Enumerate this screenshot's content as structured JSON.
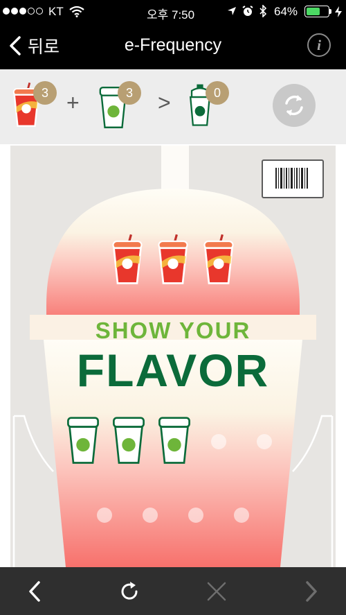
{
  "status_bar": {
    "carrier": "KT",
    "time": "오후 7:50",
    "battery_percent": "64%",
    "signal_bars_filled": 3,
    "signal_bars_total": 5,
    "battery_level": 0.64
  },
  "nav": {
    "back_label": "뒤로",
    "title": "e-Frequency",
    "info_glyph": "i"
  },
  "progress": {
    "seasonal_count": "3",
    "regular_count": "3",
    "reward_count": "0",
    "plus_symbol": "+",
    "greater_symbol": ">"
  },
  "card": {
    "headline_line1": "SHOW YOUR",
    "headline_line2": "FLAVOR",
    "seasonal_stamps_collected": 3,
    "regular_stamps_collected": 3,
    "regular_slots_total": 9
  },
  "toolbar": {
    "icons": [
      "back-arrow-icon",
      "reload-icon",
      "close-icon",
      "forward-arrow-icon"
    ]
  },
  "colors": {
    "seasonal_red": "#e8372c",
    "starbucks_green": "#0b6b3a",
    "light_green": "#6eb53a",
    "badge_gold": "#b89f73",
    "battery_green": "#4cd964"
  }
}
